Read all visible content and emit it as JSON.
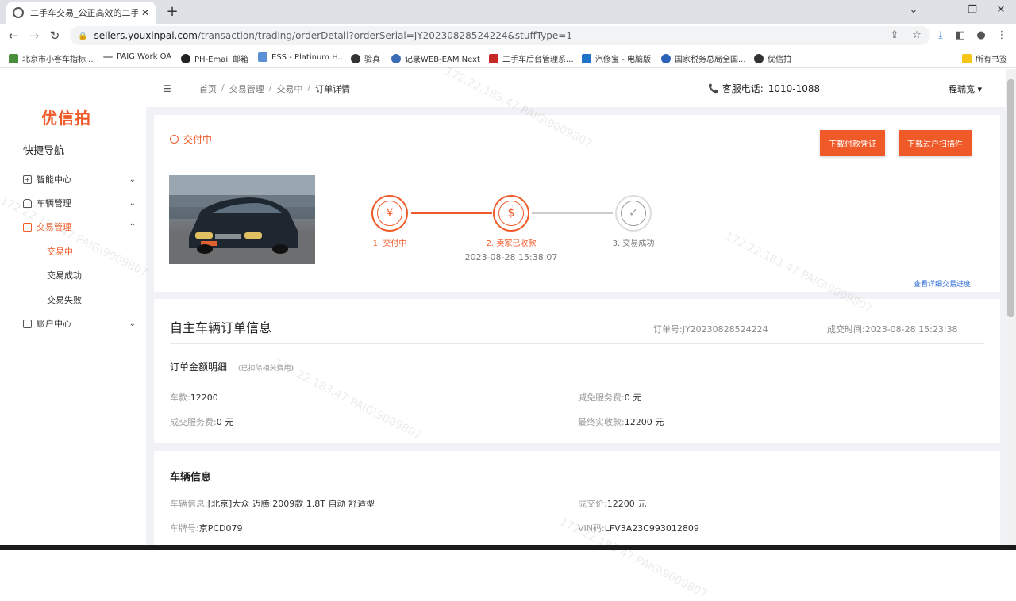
{
  "browser": {
    "tab_title": "二手车交易_公正高效的二手车交",
    "url_host": "sellers.youxinpai.com",
    "url_path": "/transaction/trading/orderDetail?orderSerial=JY20230828524224&stuffType=1",
    "bookmarks": [
      "北京市小客车指标...",
      "PAIG Work OA",
      "PH-Email 邮箱",
      "ESS - Platinum H...",
      "验真",
      "记录WEB-EAM Next",
      "二手车后台管理系...",
      "汽修宝 - 电脑版",
      "国家税务总局全国...",
      "优信拍"
    ],
    "all_bookmarks": "所有书签"
  },
  "sidebar": {
    "logo": "优信拍",
    "quicknav": "快捷导航",
    "items": [
      {
        "label": "智能中心",
        "chevron": "⌄"
      },
      {
        "label": "车辆管理",
        "chevron": "⌄"
      },
      {
        "label": "交易管理",
        "chevron": "⌃"
      },
      {
        "label": "账户中心",
        "chevron": "⌄"
      }
    ],
    "subitems": [
      "交易中",
      "交易成功",
      "交易失败"
    ]
  },
  "header": {
    "breadcrumb": [
      "首页",
      "交易管理",
      "交易中",
      "订单详情"
    ],
    "hotline_label": "客服电话:",
    "hotline_number": "1010-1088",
    "user_name": "程瑞宽 ▾"
  },
  "status_card": {
    "status": "交付中",
    "btn_payment": "下载付款凭证",
    "btn_transfer": "下载过户扫描件",
    "steps": [
      {
        "label": "1. 交付中",
        "icon": "¥",
        "state": "done"
      },
      {
        "label": "2. 卖家已收款",
        "icon": "$",
        "state": "done",
        "time": "2023-08-28 15:38:07"
      },
      {
        "label": "3. 交易成功",
        "icon": "✓",
        "state": "todo"
      }
    ],
    "detail_link": "查看详细交易进度"
  },
  "order_card": {
    "title": "自主车辆订单信息",
    "order_no_label": "订单号:",
    "order_no": "JY20230828524224",
    "deal_time_label": "成交时间:",
    "deal_time": "2023-08-28 15:23:38",
    "amount_title": "订单金额明细",
    "amount_note": "(已扣除相关费用)",
    "car_price_label": "车款:",
    "car_price": "12200",
    "reduce_fee_label": "减免服务费:",
    "reduce_fee": "0 元",
    "service_fee_label": "成交服务费:",
    "service_fee": "0 元",
    "final_label": "最终实收款:",
    "final": "12200 元"
  },
  "vehicle_card": {
    "title": "车辆信息",
    "info_label": "车辆信息:",
    "info": "[北京]大众 迈腾 2009款 1.8T 自动 舒适型",
    "price_label": "成交价:",
    "price": "12200 元",
    "plate_label": "车牌号:",
    "plate": "京PCD079",
    "vin_label": "VIN码:",
    "vin": "LFV3A23C993012809"
  },
  "watermark": "172.22.183.47 PAIG\\9009807",
  "colors": {
    "accent": "#f05a28",
    "link": "#2f6fd6"
  }
}
